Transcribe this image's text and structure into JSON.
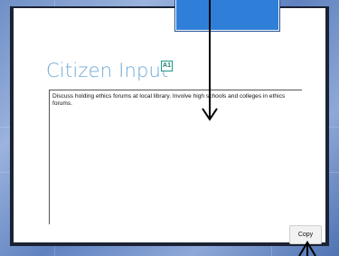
{
  "slide": {
    "title": "Citizen Input",
    "comment_marker": "A1",
    "body_text": "Discuss holding ethics forums at local library. Involve high schools and colleges in ethics forums."
  },
  "controls": {
    "copy_label": "Copy"
  },
  "colors": {
    "background": "#6f8fc6",
    "blue_box": "#2f7fd8",
    "title": "#6fa9d6"
  }
}
